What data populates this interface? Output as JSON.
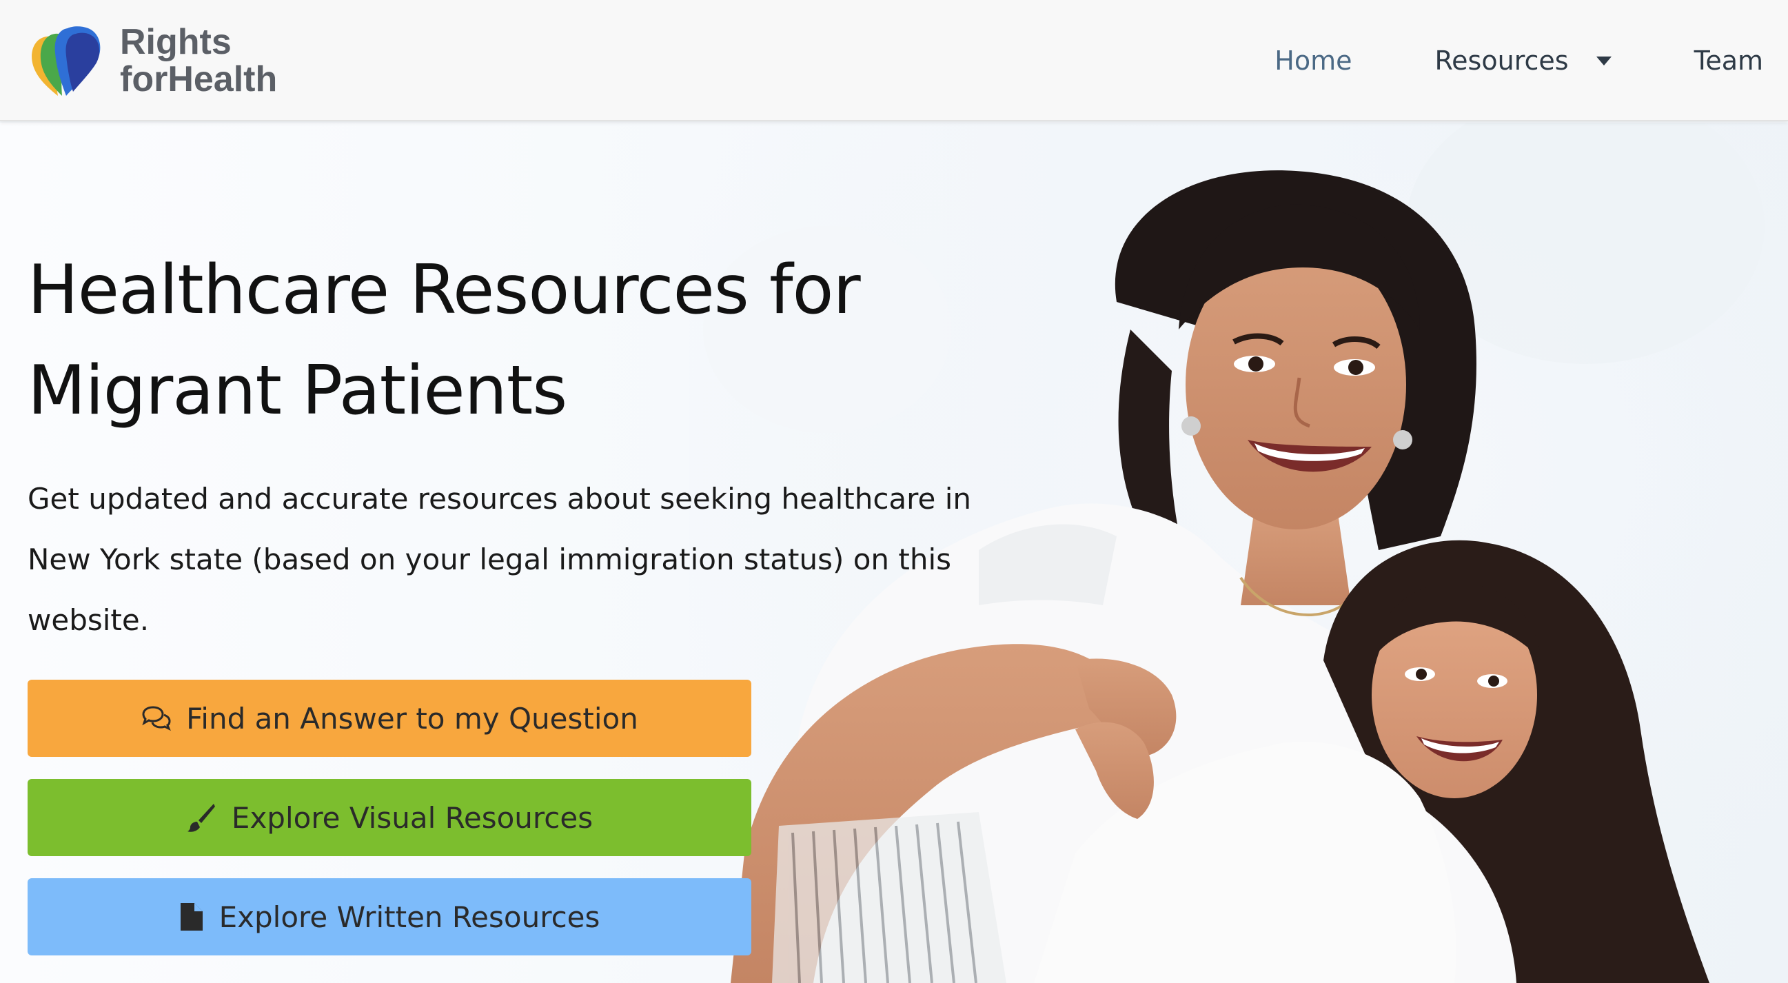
{
  "brand": {
    "line1": "Rights",
    "line2": "forHealth"
  },
  "nav": {
    "home": "Home",
    "resources": "Resources",
    "team": "Team"
  },
  "hero": {
    "title": "Healthcare Resources for Migrant Patients",
    "description": "Get updated and accurate resources about seeking healthcare in New York state (based on your legal immigration status) on this website.",
    "buttons": {
      "question": "Find an Answer to my Question",
      "visual": "Explore Visual Resources",
      "written": "Explore Written Resources"
    }
  },
  "colors": {
    "question_button": "#f8a73e",
    "visual_button": "#7cbe2e",
    "written_button": "#7dbbfa",
    "nav_home": "#4b6985"
  },
  "icons": {
    "question": "comments-icon",
    "visual": "paintbrush-icon",
    "written": "file-icon"
  }
}
